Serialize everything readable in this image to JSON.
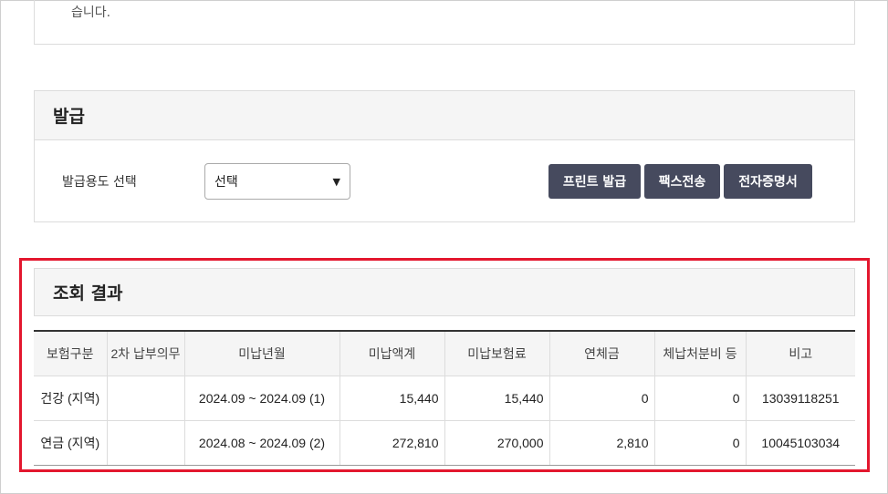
{
  "notice": {
    "text_tail": "습니다."
  },
  "issue": {
    "title": "발급",
    "purpose_label": "발급용도 선택",
    "purpose_select_value": "선택",
    "buttons": {
      "print": "프린트 발급",
      "fax": "팩스전송",
      "cert": "전자증명서"
    }
  },
  "result": {
    "title": "조회 결과",
    "columns": [
      "보험구분",
      "2차 납부의무",
      "미납년월",
      "미납액계",
      "미납보험료",
      "연체금",
      "체납처분비 등",
      "비고"
    ],
    "rows": [
      {
        "type": "건강 (지역)",
        "secondary": "",
        "period": "2024.09 ~ 2024.09 (1)",
        "total": "15,440",
        "premium": "15,440",
        "late_fee": "0",
        "disposition": "0",
        "note": "13039118251"
      },
      {
        "type": "연금 (지역)",
        "secondary": "",
        "period": "2024.08 ~ 2024.09 (2)",
        "total": "272,810",
        "premium": "270,000",
        "late_fee": "2,810",
        "disposition": "0",
        "note": "10045103034"
      }
    ]
  },
  "colors": {
    "highlight_border": "#e3172e",
    "button_bg": "#464a5e",
    "header_bg": "#f5f5f5"
  }
}
